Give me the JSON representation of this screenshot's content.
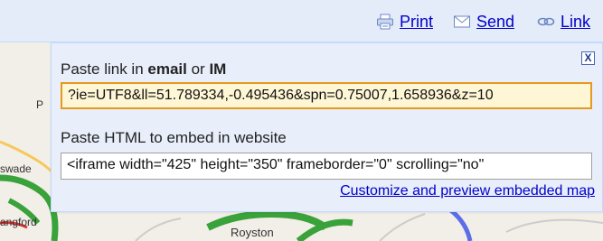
{
  "toolbar": {
    "items": [
      {
        "label": "Print",
        "icon": "printer-icon"
      },
      {
        "label": "Send",
        "icon": "envelope-icon"
      },
      {
        "label": "Link",
        "icon": "link-chain-icon"
      }
    ]
  },
  "map": {
    "places": [
      "swade",
      "angford",
      "Royston",
      "P"
    ]
  },
  "popup": {
    "close_label": "X",
    "email_label_prefix": "Paste link in ",
    "email_label_bold1": "email",
    "email_label_mid": " or ",
    "email_label_bold2": "IM",
    "link_value": "?ie=UTF8&ll=51.789334,-0.495436&spn=0.75007,1.658936&z=10",
    "embed_label": "Paste HTML to embed in website",
    "embed_value": "<iframe width=\"425\" height=\"350\" frameborder=\"0\" scrolling=\"no\"",
    "customize_link": "Customize and preview embedded map"
  },
  "colors": {
    "toolbar_bg": "#e5ecf9",
    "popup_bg": "#e8eefa",
    "link_color": "#0000cc",
    "highlight_border": "#e59a1c",
    "highlight_bg": "#fff6d5"
  }
}
